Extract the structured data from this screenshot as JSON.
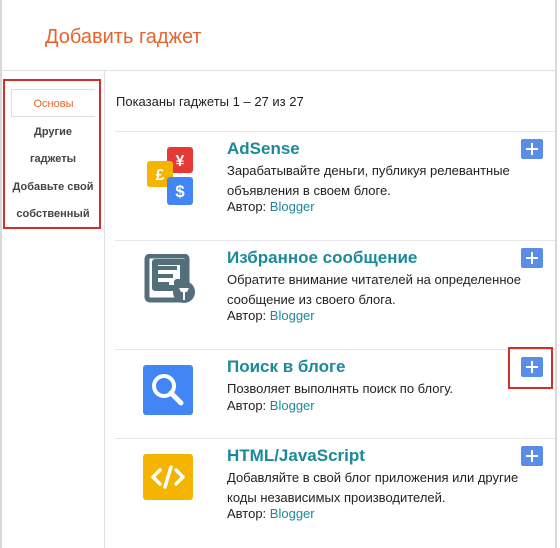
{
  "dialog": {
    "title": "Добавить гаджет"
  },
  "sidebar": {
    "items": [
      {
        "label": "Основы",
        "active": true
      },
      {
        "label": "Другие гаджеты",
        "line1": "Другие",
        "line2": "гаджеты"
      },
      {
        "label": "Добавьте свой собственный",
        "line1": "Добавьте свой",
        "line2": "собственный"
      }
    ]
  },
  "main": {
    "count_text": "Показаны гаджеты 1 – 27 из 27",
    "author_prefix": "Автор:",
    "gadgets": [
      {
        "title": "AdSense",
        "description": "Зарабатывайте деньги, публикуя релевантные объявления в своем блоге.",
        "author": "Blogger",
        "icon": "adsense-currency-icon"
      },
      {
        "title": "Избранное сообщение",
        "description": "Обратите внимание читателей на определенное сообщение из своего блога.",
        "author": "Blogger",
        "icon": "pinned-post-icon"
      },
      {
        "title": "Поиск в блоге",
        "description": "Позволяет выполнять поиск по блогу.",
        "author": "Blogger",
        "icon": "search-icon"
      },
      {
        "title": "HTML/JavaScript",
        "description": "Добавляйте в свой блог приложения или другие коды независимых производителей.",
        "author": "Blogger",
        "icon": "code-icon"
      }
    ]
  },
  "colors": {
    "accent": "#e8632b",
    "title_link": "#1a8a9b",
    "add_button": "#5a8de6",
    "highlight": "#d32f2f"
  }
}
